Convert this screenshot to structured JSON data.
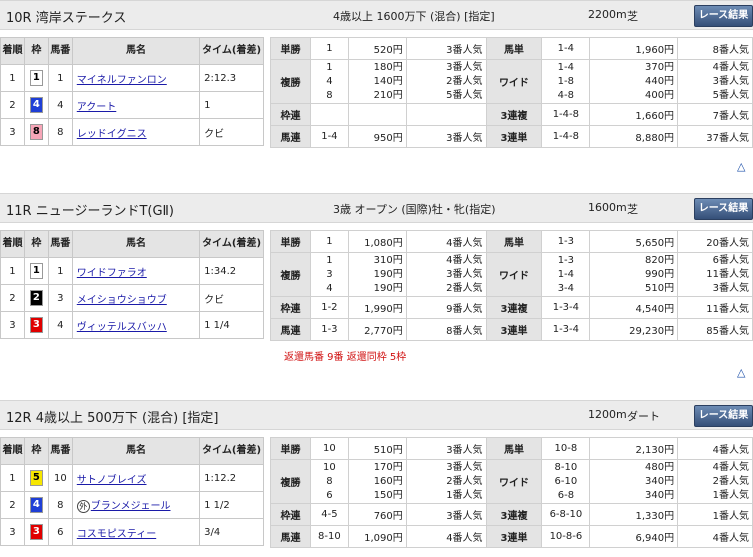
{
  "colors": {
    "waku1": "#ffffff",
    "waku2": "#000000",
    "waku3": "#e00000",
    "waku4": "#1f3fd6",
    "waku5": "#f6e600",
    "waku8": "#f7a6b8"
  },
  "common": {
    "headers": {
      "rank": "着順",
      "waku": "枠",
      "num": "馬番",
      "name": "馬名",
      "time": "タイム(着差)"
    },
    "button": "レース結果",
    "up_icon": "△"
  },
  "races": [
    {
      "title": "10R 湾岸ステークス",
      "cond": "4歳以上 1600万下 (混合) [指定]",
      "dist": "2200m",
      "surf": "芝",
      "results": [
        {
          "rank": "1",
          "waku": "1",
          "num": "1",
          "name": "マイネルファンロン",
          "foreign": "",
          "time": "2:12.3"
        },
        {
          "rank": "2",
          "waku": "4",
          "num": "4",
          "name": "アクート",
          "foreign": "",
          "time": "1"
        },
        {
          "rank": "3",
          "waku": "8",
          "num": "8",
          "name": "レッドイグニス",
          "foreign": "",
          "time": "クビ"
        }
      ],
      "pay": {
        "tansho": {
          "label": "単勝",
          "comb": "1",
          "yen": "520円",
          "pop": "3番人気"
        },
        "fukusho": {
          "label": "複勝",
          "items": [
            {
              "comb": "1",
              "yen": "180円",
              "pop": "3番人気"
            },
            {
              "comb": "4",
              "yen": "140円",
              "pop": "2番人気"
            },
            {
              "comb": "8",
              "yen": "210円",
              "pop": "5番人気"
            }
          ]
        },
        "wakuren": {
          "label": "枠連",
          "comb": "",
          "yen": "",
          "pop": ""
        },
        "umaren": {
          "label": "馬連",
          "comb": "1-4",
          "yen": "950円",
          "pop": "3番人気"
        },
        "umatan": {
          "label": "馬単",
          "comb": "1-4",
          "yen": "1,960円",
          "pop": "8番人気"
        },
        "wide": {
          "label": "ワイド",
          "items": [
            {
              "comb": "1-4",
              "yen": "370円",
              "pop": "4番人気"
            },
            {
              "comb": "1-8",
              "yen": "440円",
              "pop": "3番人気"
            },
            {
              "comb": "4-8",
              "yen": "400円",
              "pop": "5番人気"
            }
          ]
        },
        "sanrenpuku": {
          "label": "3連複",
          "comb": "1-4-8",
          "yen": "1,660円",
          "pop": "7番人気"
        },
        "sanrentan": {
          "label": "3連単",
          "comb": "1-4-8",
          "yen": "8,880円",
          "pop": "37番人気"
        }
      },
      "note": ""
    },
    {
      "title": "11R ニュージーランドT(GⅡ)",
      "cond": "3歳 オープン (国際)牡・牝(指定)",
      "dist": "1600m",
      "surf": "芝",
      "results": [
        {
          "rank": "1",
          "waku": "1",
          "num": "1",
          "name": "ワイドファラオ",
          "foreign": "",
          "time": "1:34.2"
        },
        {
          "rank": "2",
          "waku": "2",
          "num": "3",
          "name": "メイショウショウブ",
          "foreign": "",
          "time": "クビ"
        },
        {
          "rank": "3",
          "waku": "3",
          "num": "4",
          "name": "ヴィッテルスバッハ",
          "foreign": "",
          "time": "1 1/4"
        }
      ],
      "pay": {
        "tansho": {
          "label": "単勝",
          "comb": "1",
          "yen": "1,080円",
          "pop": "4番人気"
        },
        "fukusho": {
          "label": "複勝",
          "items": [
            {
              "comb": "1",
              "yen": "310円",
              "pop": "4番人気"
            },
            {
              "comb": "3",
              "yen": "190円",
              "pop": "3番人気"
            },
            {
              "comb": "4",
              "yen": "190円",
              "pop": "2番人気"
            }
          ]
        },
        "wakuren": {
          "label": "枠連",
          "comb": "1-2",
          "yen": "1,990円",
          "pop": "9番人気"
        },
        "umaren": {
          "label": "馬連",
          "comb": "1-3",
          "yen": "2,770円",
          "pop": "8番人気"
        },
        "umatan": {
          "label": "馬単",
          "comb": "1-3",
          "yen": "5,650円",
          "pop": "20番人気"
        },
        "wide": {
          "label": "ワイド",
          "items": [
            {
              "comb": "1-3",
              "yen": "820円",
              "pop": "6番人気"
            },
            {
              "comb": "1-4",
              "yen": "990円",
              "pop": "11番人気"
            },
            {
              "comb": "3-4",
              "yen": "510円",
              "pop": "3番人気"
            }
          ]
        },
        "sanrenpuku": {
          "label": "3連複",
          "comb": "1-3-4",
          "yen": "4,540円",
          "pop": "11番人気"
        },
        "sanrentan": {
          "label": "3連単",
          "comb": "1-3-4",
          "yen": "29,230円",
          "pop": "85番人気"
        }
      },
      "note": "返還馬番 9番 返還同枠 5枠"
    },
    {
      "title": "12R 4歳以上 500万下 (混合) [指定]",
      "cond": "",
      "dist": "1200m",
      "surf": "ダート",
      "results": [
        {
          "rank": "1",
          "waku": "5",
          "num": "10",
          "name": "サトノブレイズ",
          "foreign": "",
          "time": "1:12.2"
        },
        {
          "rank": "2",
          "waku": "4",
          "num": "8",
          "name": "ブランメジェール",
          "foreign": "外",
          "time": "1 1/2"
        },
        {
          "rank": "3",
          "waku": "3",
          "num": "6",
          "name": "コスモピスティー",
          "foreign": "",
          "time": "3/4"
        }
      ],
      "pay": {
        "tansho": {
          "label": "単勝",
          "comb": "10",
          "yen": "510円",
          "pop": "3番人気"
        },
        "fukusho": {
          "label": "複勝",
          "items": [
            {
              "comb": "10",
              "yen": "170円",
              "pop": "3番人気"
            },
            {
              "comb": "8",
              "yen": "160円",
              "pop": "2番人気"
            },
            {
              "comb": "6",
              "yen": "150円",
              "pop": "1番人気"
            }
          ]
        },
        "wakuren": {
          "label": "枠連",
          "comb": "4-5",
          "yen": "760円",
          "pop": "3番人気"
        },
        "umaren": {
          "label": "馬連",
          "comb": "8-10",
          "yen": "1,090円",
          "pop": "4番人気"
        },
        "umatan": {
          "label": "馬単",
          "comb": "10-8",
          "yen": "2,130円",
          "pop": "4番人気"
        },
        "wide": {
          "label": "ワイド",
          "items": [
            {
              "comb": "8-10",
              "yen": "480円",
              "pop": "4番人気"
            },
            {
              "comb": "6-10",
              "yen": "340円",
              "pop": "2番人気"
            },
            {
              "comb": "6-8",
              "yen": "340円",
              "pop": "1番人気"
            }
          ]
        },
        "sanrenpuku": {
          "label": "3連複",
          "comb": "6-8-10",
          "yen": "1,330円",
          "pop": "1番人気"
        },
        "sanrentan": {
          "label": "3連単",
          "comb": "10-8-6",
          "yen": "6,940円",
          "pop": "4番人気"
        }
      },
      "note": ""
    }
  ]
}
